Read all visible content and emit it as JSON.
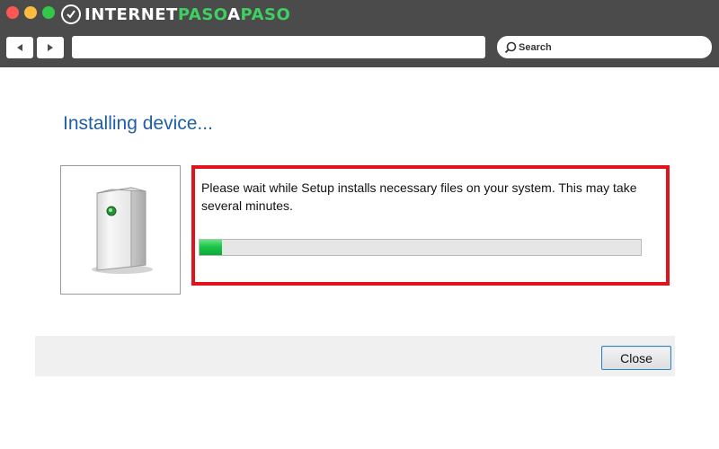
{
  "browser": {
    "logo": {
      "part_white_1": "INTERNET",
      "part_green": "PASO",
      "part_white_2": "A",
      "part_green_2": "PASO"
    },
    "nav": {
      "back_icon": "triangle-left-icon",
      "forward_icon": "triangle-right-icon"
    },
    "address": {
      "value": ""
    },
    "search": {
      "label": "Search",
      "icon": "search-icon"
    }
  },
  "dialog": {
    "title": "Installing device...",
    "device_icon": "pc-tower-icon",
    "message": "Please wait while Setup installs necessary files on your system. This may take several minutes.",
    "progress": {
      "fraction": 0.05,
      "color": "#1cc44a"
    },
    "highlight_color": "#e1141e",
    "close_label": "Close"
  }
}
